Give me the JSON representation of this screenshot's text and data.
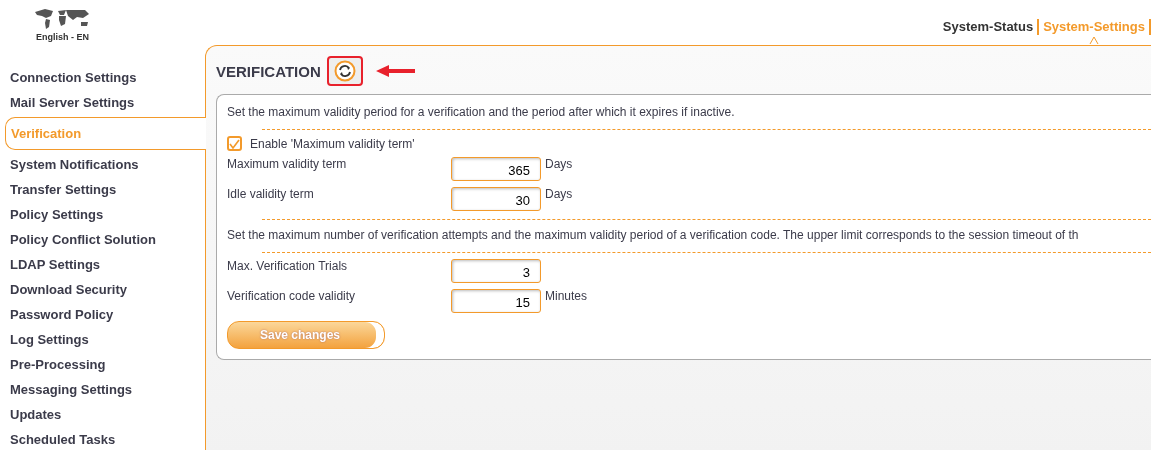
{
  "language": "English - EN",
  "top_nav": [
    {
      "label": "System-Status",
      "selected": false
    },
    {
      "label": "System-Settings",
      "selected": true
    }
  ],
  "sidebar": {
    "items": [
      {
        "label": "Connection Settings",
        "selected": false
      },
      {
        "label": "Mail Server Settings",
        "selected": false
      },
      {
        "label": "Verification",
        "selected": true
      },
      {
        "label": "System Notifications",
        "selected": false
      },
      {
        "label": "Transfer Settings",
        "selected": false
      },
      {
        "label": "Policy Settings",
        "selected": false
      },
      {
        "label": "Policy Conflict Solution",
        "selected": false
      },
      {
        "label": "LDAP Settings",
        "selected": false
      },
      {
        "label": "Download Security",
        "selected": false
      },
      {
        "label": "Password Policy",
        "selected": false
      },
      {
        "label": "Log Settings",
        "selected": false
      },
      {
        "label": "Pre-Processing",
        "selected": false
      },
      {
        "label": "Messaging Settings",
        "selected": false
      },
      {
        "label": "Updates",
        "selected": false
      },
      {
        "label": "Scheduled Tasks",
        "selected": false
      }
    ]
  },
  "page": {
    "title": "VERIFICATION",
    "sections": [
      {
        "description": "Set the maximum validity period for a verification and the period after which it expires if inactive.",
        "checkbox": {
          "label": "Enable 'Maximum validity term'",
          "checked": true
        },
        "fields": [
          {
            "label": "Maximum validity term",
            "value": "365",
            "unit": "Days"
          },
          {
            "label": "Idle validity term",
            "value": "30",
            "unit": "Days"
          }
        ]
      },
      {
        "description": "Set the maximum number of verification attempts and the maximum validity period of a verification code. The upper limit corresponds to the session timeout of th",
        "fields": [
          {
            "label": "Max. Verification Trials",
            "value": "3"
          },
          {
            "label": "Verification code validity",
            "value": "15",
            "unit": "Minutes"
          }
        ]
      }
    ],
    "save_button": "Save changes"
  }
}
